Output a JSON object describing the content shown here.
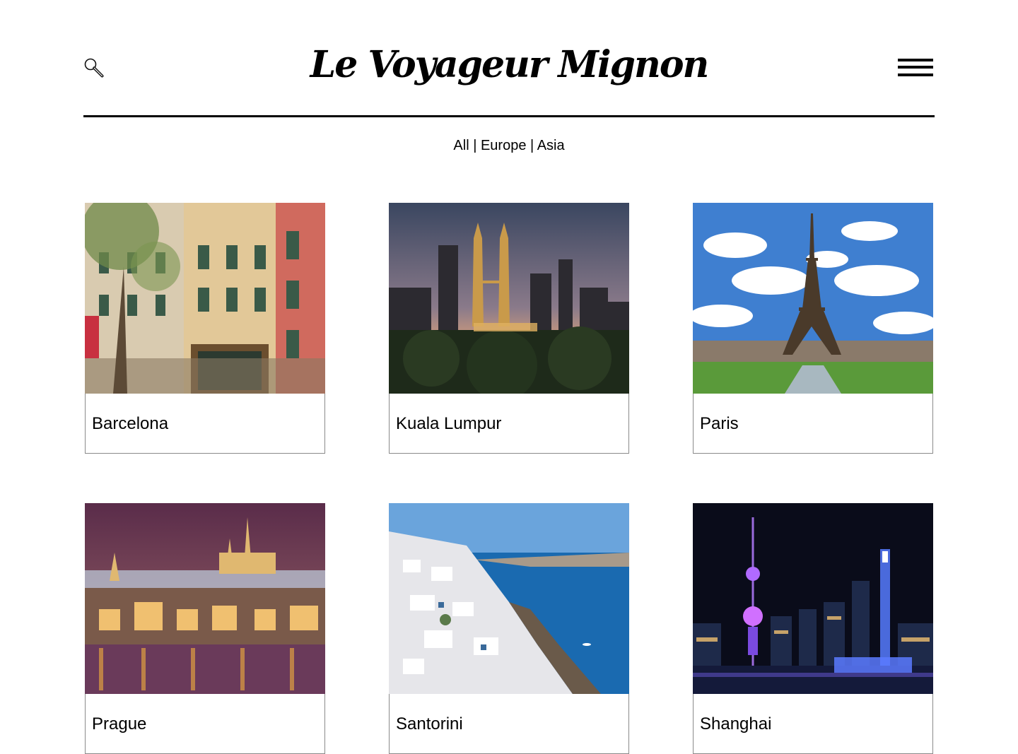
{
  "header": {
    "logo": "Le Voyageur Mignon",
    "search_icon": "search-icon",
    "menu_icon": "hamburger-menu-icon"
  },
  "filters": {
    "items": [
      "All",
      "Europe",
      "Asia"
    ],
    "separator": "|"
  },
  "destinations": [
    {
      "name": "Barcelona"
    },
    {
      "name": "Kuala Lumpur"
    },
    {
      "name": "Paris"
    },
    {
      "name": "Prague"
    },
    {
      "name": "Santorini"
    },
    {
      "name": "Shanghai"
    }
  ]
}
